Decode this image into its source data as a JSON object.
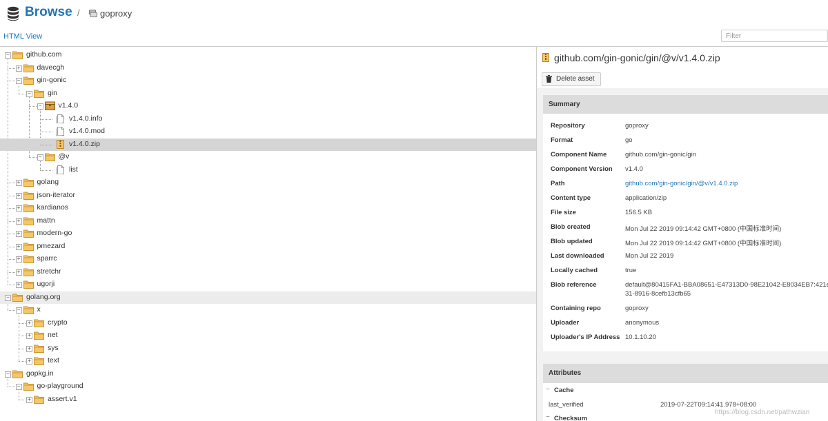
{
  "header": {
    "title": "Browse",
    "separator": "/",
    "repository": "goproxy"
  },
  "toolbar": {
    "html_view_label": "HTML View",
    "filter_placeholder": "Filter"
  },
  "tree": {
    "nodes": [
      {
        "label": "github.com"
      },
      {
        "label": "davecgh"
      },
      {
        "label": "gin-gonic"
      },
      {
        "label": "gin"
      },
      {
        "label": "v1.4.0"
      },
      {
        "label": "v1.4.0.info"
      },
      {
        "label": "v1.4.0.mod"
      },
      {
        "label": "v1.4.0.zip"
      },
      {
        "label": "@v"
      },
      {
        "label": "list"
      },
      {
        "label": "golang"
      },
      {
        "label": "json-iterator"
      },
      {
        "label": "kardianos"
      },
      {
        "label": "mattn"
      },
      {
        "label": "modern-go"
      },
      {
        "label": "pmezard"
      },
      {
        "label": "sparrc"
      },
      {
        "label": "stretchr"
      },
      {
        "label": "ugorji"
      },
      {
        "label": "golang.org"
      },
      {
        "label": "x"
      },
      {
        "label": "crypto"
      },
      {
        "label": "net"
      },
      {
        "label": "sys"
      },
      {
        "label": "text"
      },
      {
        "label": "gopkg.in"
      },
      {
        "label": "go-playground"
      },
      {
        "label": "assert.v1"
      }
    ]
  },
  "detail": {
    "asset_title": "github.com/gin-gonic/gin/@v/v1.4.0.zip",
    "delete_label": "Delete asset",
    "summary_header": "Summary",
    "summary": [
      {
        "key": "Repository",
        "value": "goproxy"
      },
      {
        "key": "Format",
        "value": "go"
      },
      {
        "key": "Component Name",
        "value": "github.com/gin-gonic/gin"
      },
      {
        "key": "Component Version",
        "value": "v1.4.0"
      },
      {
        "key": "Path",
        "value": "github.com/gin-gonic/gin/@v/v1.4.0.zip"
      },
      {
        "key": "Content type",
        "value": "application/zip"
      },
      {
        "key": "File size",
        "value": "156.5 KB"
      },
      {
        "key": "Blob created",
        "value": "Mon Jul 22 2019 09:14:42 GMT+0800 (中国标准时间)"
      },
      {
        "key": "Blob updated",
        "value": "Mon Jul 22 2019 09:14:42 GMT+0800 (中国标准时间)"
      },
      {
        "key": "Last downloaded",
        "value": "Mon Jul 22 2019"
      },
      {
        "key": "Locally cached",
        "value": "true"
      },
      {
        "key": "Blob reference",
        "value": "default@80415FA1-BBA08651-E47313D0-98E21042-E8034EB7:421e",
        "value2": "31-8916-8cefb13cfb65"
      },
      {
        "key": "Containing repo",
        "value": "goproxy"
      },
      {
        "key": "Uploader",
        "value": "anonymous"
      },
      {
        "key": "Uploader's IP Address",
        "value": "10.1.10.20"
      }
    ],
    "attributes_header": "Attributes",
    "cache_label": "Cache",
    "last_verified_key": "last_verified",
    "last_verified_value": "2019-07-22T09:14:41.978+08:00",
    "checksum_label": "Checksum",
    "collapse_glyph": "−"
  },
  "watermark": "https://blog.csdn.net/pathwzian",
  "colors": {
    "accent": "#2077b3",
    "selected_row": "#d5d5d5",
    "folder": "#f5c66a"
  }
}
